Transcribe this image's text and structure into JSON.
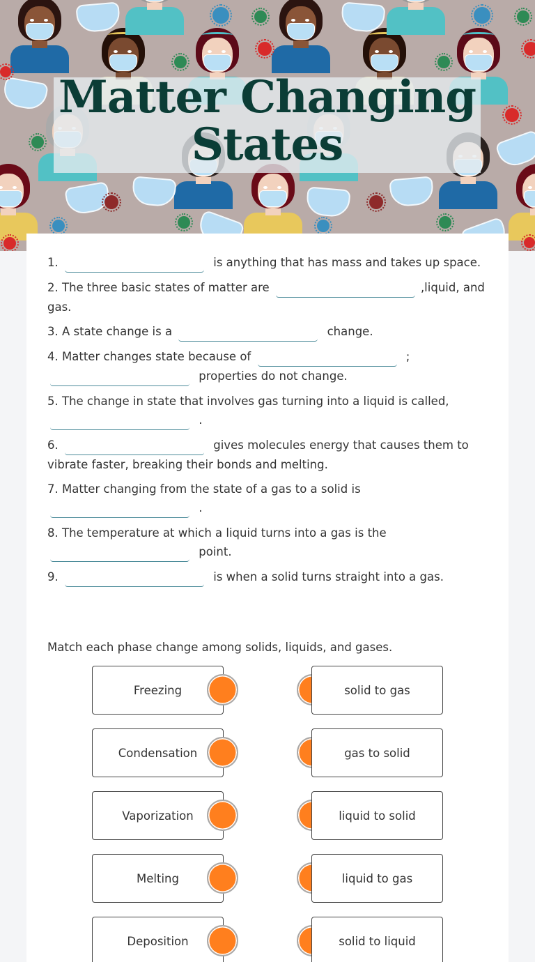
{
  "banner": {
    "title_line1": "Matter Changing",
    "title_line2": "States",
    "background_color": "#b9aba8",
    "title_color": "#0b3d36"
  },
  "questions": [
    {
      "number": "1.",
      "before": "",
      "after": "is anything that has mass and takes up space."
    },
    {
      "number": "2.",
      "before": "The three basic states of matter are",
      "after": ",liquid, and gas."
    },
    {
      "number": "3.",
      "before": "A state change is a",
      "after": "change."
    },
    {
      "number": "4.",
      "before": "Matter changes state because of",
      "middle": ";",
      "after": "properties do not change."
    },
    {
      "number": "5.",
      "before": "The change in state that involves gas turning into a liquid is called,",
      "after": "."
    },
    {
      "number": "6.",
      "before": "",
      "after": "gives molecules energy that causes them to vibrate faster, breaking their bonds and melting."
    },
    {
      "number": "7.",
      "before": "Matter changing from the state of a gas to a solid is",
      "after": "."
    },
    {
      "number": "8.",
      "before": "The temperature at which a liquid turns into a gas is the",
      "after": "point."
    },
    {
      "number": "9.",
      "before": "",
      "after": "is when a solid turns straight into a gas."
    }
  ],
  "blanks": {
    "value": "",
    "accent_color": "#4a8a99"
  },
  "matching": {
    "instructions": "Match each phase change among solids, liquids, and gases.",
    "left": [
      "Freezing",
      "Condensation",
      "Vaporization",
      "Melting",
      "Deposition"
    ],
    "right": [
      "solid to gas",
      "gas to solid",
      "liquid to solid",
      "liquid to gas",
      "solid to liquid"
    ],
    "dot_color": "#ff7f1e"
  }
}
